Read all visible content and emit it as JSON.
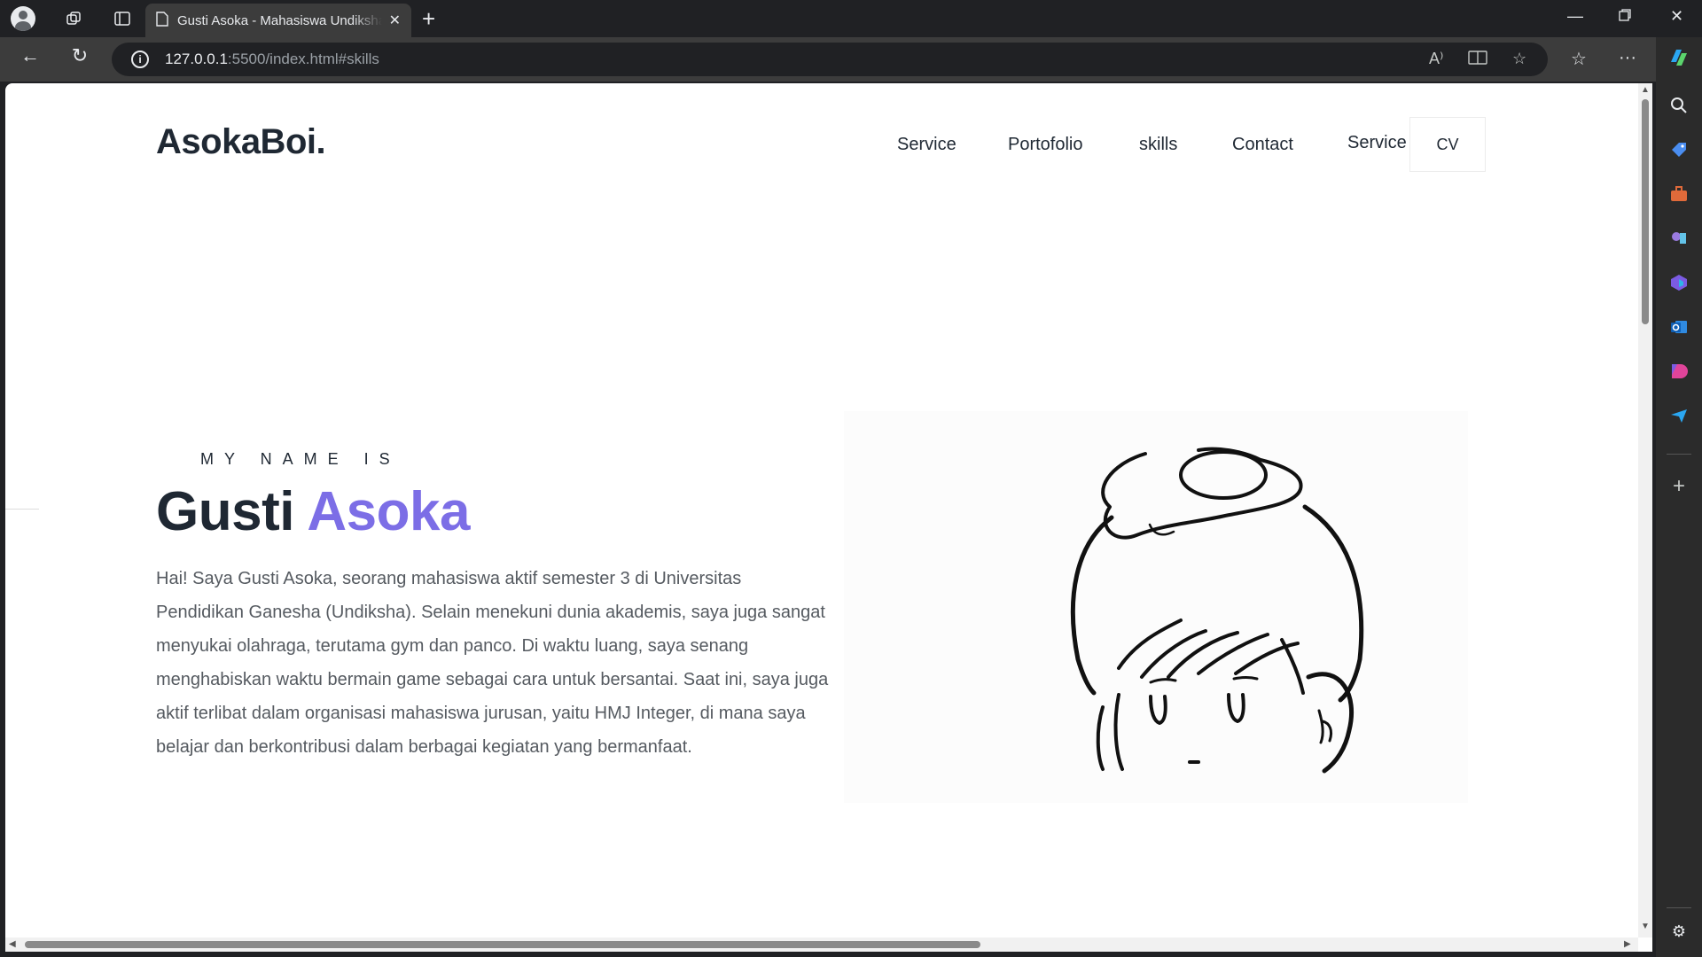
{
  "browser": {
    "tab_title": "Gusti Asoka - Mahasiswa Undiksha",
    "url_host": "127.0.0.1",
    "url_path": ":5500/index.html#skills",
    "read_aloud_label": "A⁾"
  },
  "site": {
    "logo": "AsokaBoi.",
    "nav": [
      "Service",
      "Portofolio",
      "skills",
      "Contact",
      "Service"
    ],
    "cv_label": "CV",
    "kicker": "MY NAME IS",
    "name_first": "Gusti",
    "name_accent": "Asoka",
    "bio": "Hai! Saya Gusti Asoka, seorang mahasiswa aktif semester 3 di Universitas Pendidikan Ganesha (Undiksha). Selain menekuni dunia akademis, saya juga sangat menyukai olahraga, terutama gym dan panco. Di waktu luang, saya senang menghabiskan waktu bermain game sebagai cara untuk bersantai. Saat ini, saya juga aktif terlibat dalam organisasi mahasiswa jurusan, yaitu HMJ Integer, di mana saya belajar dan berkontribusi dalam berbagai kegiatan yang bermanfaat."
  },
  "colors": {
    "accent": "#7c6ee6",
    "heading": "#1f2833",
    "body_text": "#555a60"
  }
}
